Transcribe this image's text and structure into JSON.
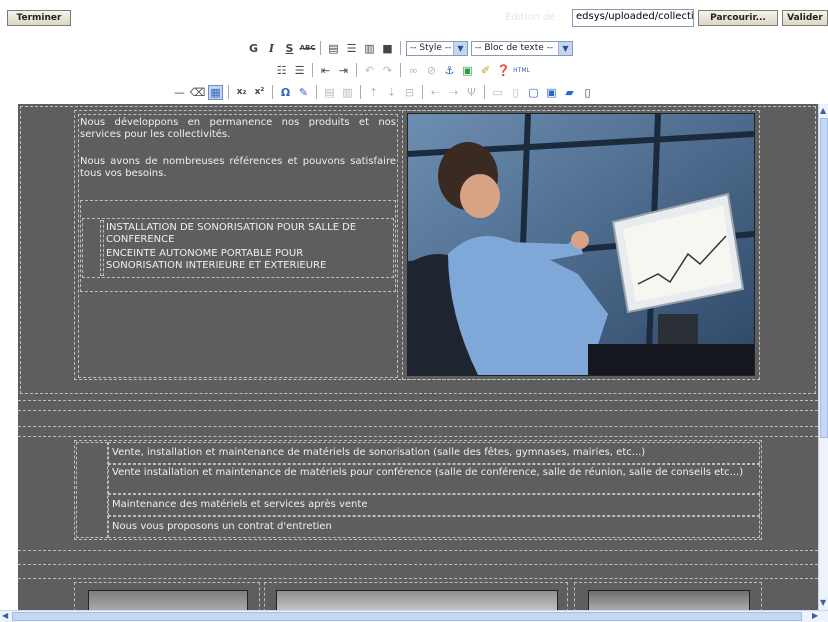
{
  "topbar": {
    "finish_label": "Terminer",
    "edition_label": "Edition de :",
    "path_value": "edsys/uploaded/collectiv",
    "browse_label": "Parcourir...",
    "validate_label": "Valider"
  },
  "toolbar": {
    "bold": "G",
    "italic": "I",
    "underline": "S",
    "strike": "ABC",
    "style_select": "-- Style --",
    "block_select": "-- Bloc de texte --",
    "html_label": "HTML"
  },
  "content": {
    "para1": "Nous développons en permanence nos produits et nos services pour les collectivités.",
    "para2": "Nous avons de nombreuses références et pouvons satisfaire tous vos besoins.",
    "list_items": [
      "INSTALLATION DE SONORISATION POUR SALLE DE CONFERENCE",
      "ENCEINTE AUTONOME PORTABLE POUR SONORISATION INTERIEURE ET EXTERIEURE"
    ],
    "services": [
      "Vente, installation et maintenance de matériels de sonorisation (salle des fêtes, gymnases, mairies, etc...)",
      "Vente installation et maintenance de matériels pour conférence (salle de conférence, salle de réunion, salle de conseils etc...)",
      "Maintenance des matériels et services après vente",
      "Nous vous proposons un contrat d'entretien"
    ]
  },
  "colors": {
    "editor_bg": "#5e5e5e",
    "dash_border": "#bdbdbd",
    "toolbar_select_blue": "#c5d5f2"
  }
}
